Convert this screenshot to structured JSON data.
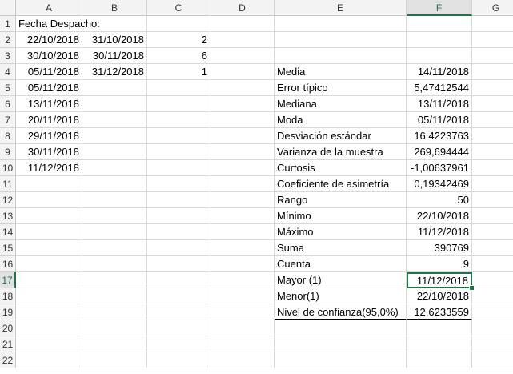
{
  "columns": [
    "A",
    "B",
    "C",
    "D",
    "E",
    "F",
    "G"
  ],
  "rows": [
    "1",
    "2",
    "3",
    "4",
    "5",
    "6",
    "7",
    "8",
    "9",
    "10",
    "11",
    "12",
    "13",
    "14",
    "15",
    "16",
    "17",
    "18",
    "19",
    "20",
    "21",
    "22"
  ],
  "cells": {
    "A1": "Fecha Despacho:",
    "A2": "22/10/2018",
    "B2": "31/10/2018",
    "C2": "2",
    "A3": "30/10/2018",
    "B3": "30/11/2018",
    "C3": "6",
    "A4": "05/11/2018",
    "B4": "31/12/2018",
    "C4": "1",
    "A5": "05/11/2018",
    "A6": "13/11/2018",
    "A7": "20/11/2018",
    "A8": "29/11/2018",
    "A9": "30/11/2018",
    "A10": "11/12/2018",
    "E4": "Media",
    "F4": "14/11/2018",
    "E5": "Error típico",
    "F5": "5,47412544",
    "E6": "Mediana",
    "F6": "13/11/2018",
    "E7": "Moda",
    "F7": "05/11/2018",
    "E8": "Desviación estándar",
    "F8": "16,4223763",
    "E9": "Varianza de la muestra",
    "F9": "269,694444",
    "E10": "Curtosis",
    "F10": "-1,00637961",
    "E11": "Coeficiente de asimetría",
    "F11": "0,19342469",
    "E12": "Rango",
    "F12": "50",
    "E13": "Mínimo",
    "F13": "22/10/2018",
    "E14": "Máximo",
    "F14": "11/12/2018",
    "E15": "Suma",
    "F15": "390769",
    "E16": "Cuenta",
    "F16": "9",
    "E17": "Mayor (1)",
    "F17": "11/12/2018",
    "E18": "Menor(1)",
    "F18": "22/10/2018",
    "E19": "Nivel de confianza(95,0%)",
    "F19": "12,6233559"
  },
  "active_cell": "F17",
  "accent_color": "#217346"
}
